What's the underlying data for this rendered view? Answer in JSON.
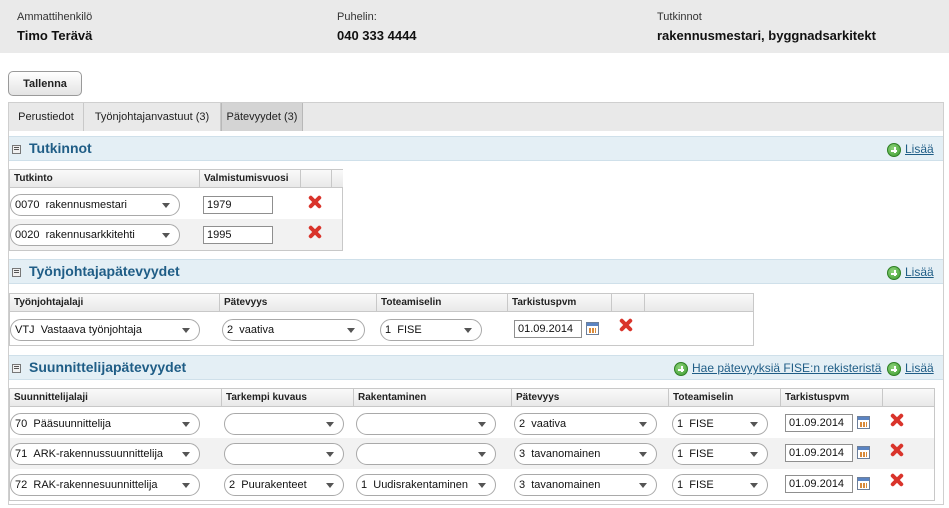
{
  "header": {
    "person_label": "Ammattihenkilö",
    "person_name": "Timo Terävä",
    "phone_label": "Puhelin:",
    "phone_value": "040 333 4444",
    "degrees_label": "Tutkinnot",
    "degrees_value": "rakennusmestari, byggnadsarkitekt"
  },
  "toolbar": {
    "save_label": "Tallenna"
  },
  "tabs": [
    {
      "label": "Perustiedot"
    },
    {
      "label": "Työnjohtajanvastuut (3)"
    },
    {
      "label": "Pätevyydet (3)"
    }
  ],
  "tutkinnot": {
    "title": "Tutkinnot",
    "add_label": "Lisää",
    "columns": [
      "Tutkinto",
      "Valmistumisvuosi"
    ],
    "rows": [
      {
        "code": "0070",
        "name": "rakennusmestari",
        "year": "1979"
      },
      {
        "code": "0020",
        "name": "rakennusarkkitehti",
        "year": "1995"
      }
    ]
  },
  "tyonjohtaja": {
    "title": "Työnjohtajapätevyydet",
    "add_label": "Lisää",
    "columns": [
      "Työnjohtajalaji",
      "Pätevyys",
      "Toteamiselin",
      "Tarkistuspvm"
    ],
    "rows": [
      {
        "laji_code": "VTJ",
        "laji": "Vastaava työnjohtaja",
        "patevyys_code": "2",
        "patevyys": "vaativa",
        "elin_code": "1",
        "elin": "FISE",
        "pvm": "01.09.2014"
      }
    ]
  },
  "suunnittelija": {
    "title": "Suunnittelijapätevyydet",
    "fise_link": "Hae pätevyyksiä FISE:n rekisteristä",
    "add_label": "Lisää",
    "columns": [
      "Suunnittelijalaji",
      "Tarkempi kuvaus",
      "Rakentaminen",
      "Pätevyys",
      "Toteamiselin",
      "Tarkistuspvm"
    ],
    "rows": [
      {
        "laji_code": "70",
        "laji": "Pääsuunnittelija",
        "kuvaus_code": "",
        "kuvaus": "",
        "rak_code": "",
        "rak": "",
        "patevyys_code": "2",
        "patevyys": "vaativa",
        "elin_code": "1",
        "elin": "FISE",
        "pvm": "01.09.2014"
      },
      {
        "laji_code": "71",
        "laji": "ARK-rakennussuunnittelija",
        "kuvaus_code": "",
        "kuvaus": "",
        "rak_code": "",
        "rak": "",
        "patevyys_code": "3",
        "patevyys": "tavanomainen",
        "elin_code": "1",
        "elin": "FISE",
        "pvm": "01.09.2014"
      },
      {
        "laji_code": "72",
        "laji": "RAK-rakennesuunnittelija",
        "kuvaus_code": "2",
        "kuvaus": "Puurakenteet",
        "rak_code": "1",
        "rak": "Uudisrakentaminen",
        "patevyys_code": "3",
        "patevyys": "tavanomainen",
        "elin_code": "1",
        "elin": "FISE",
        "pvm": "01.09.2014"
      }
    ]
  }
}
